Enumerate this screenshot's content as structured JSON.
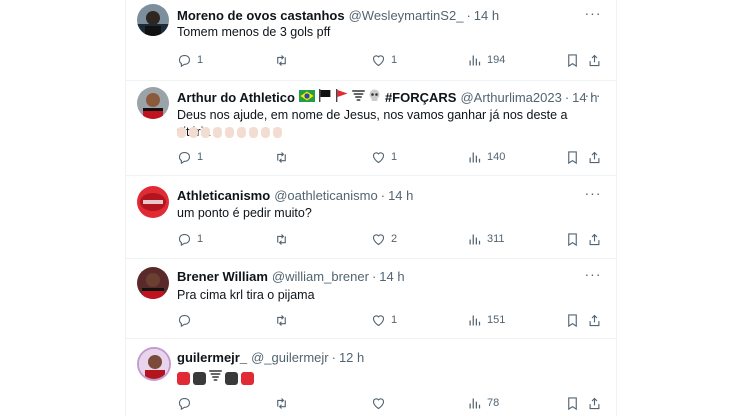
{
  "colors": {
    "text": "#0f1419",
    "secondary": "#536471",
    "divider": "#eff3f4",
    "red": "#e02b35",
    "dark": "#3a3a3a"
  },
  "tweets": [
    {
      "name": "Moreno de ovos castanhos",
      "handle": "@WesleymartinS2_",
      "dot": "·",
      "time": "14 h",
      "text": "Tomem menos de 3 gols pff",
      "replies": "1",
      "retweets": "",
      "likes": "1",
      "views": "194"
    },
    {
      "name": "Arthur do Athletico",
      "name_suffix": "#FORÇARS",
      "handle": "@Arthurlima2023",
      "dot": "·",
      "time": "14 h",
      "text": "Deus nos ajude, em nome de Jesus, nos vamos ganhar já nos deste a vitória",
      "replies": "1",
      "retweets": "",
      "likes": "1",
      "views": "140"
    },
    {
      "name": "Athleticanismo",
      "handle": "@oathleticanismo",
      "dot": "·",
      "time": "14 h",
      "text": "um ponto é pedir muito?",
      "replies": "1",
      "retweets": "",
      "likes": "2",
      "views": "311"
    },
    {
      "name": "Brener William",
      "handle": "@william_brener",
      "dot": "·",
      "time": "14 h",
      "text": "Pra cima krl tira o pijama",
      "replies": "",
      "retweets": "",
      "likes": "1",
      "views": "151"
    },
    {
      "name": "guilermejr_",
      "handle": "@_guilermejr",
      "dot": "·",
      "time": "12 h",
      "text": "",
      "replies": "",
      "retweets": "",
      "likes": "",
      "views": "78"
    }
  ],
  "more_label": "···"
}
